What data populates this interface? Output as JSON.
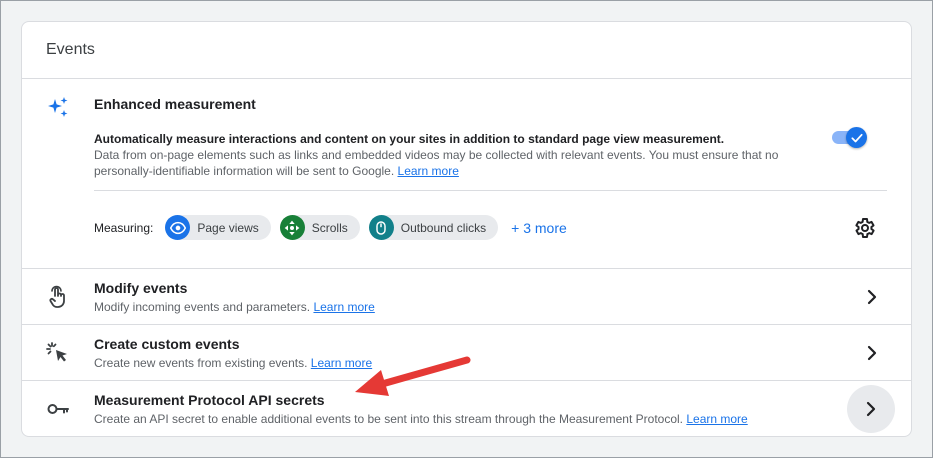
{
  "card": {
    "title": "Events"
  },
  "enhanced": {
    "title": "Enhanced measurement",
    "desc_bold": "Automatically measure interactions and content on your sites in addition to standard page view measurement.",
    "desc": "Data from on-page elements such as links and embedded videos may be collected with relevant events. You must ensure that no personally-identifiable information will be sent to Google.",
    "learn_more": "Learn more",
    "toggle_on": true,
    "measuring_label": "Measuring:",
    "chips": [
      {
        "label": "Page views",
        "icon": "eye-icon",
        "color": "#1a73e8"
      },
      {
        "label": "Scrolls",
        "icon": "scroll-arrows-icon",
        "color": "#188038"
      },
      {
        "label": "Outbound clicks",
        "icon": "mouse-icon",
        "color": "#12808a"
      }
    ],
    "more": "+ 3 more",
    "settings_icon": "gear-icon"
  },
  "rows": [
    {
      "title": "Modify events",
      "sub": "Modify incoming events and parameters.",
      "learn_more": "Learn more",
      "icon": "touch-hand-icon"
    },
    {
      "title": "Create custom events",
      "sub": "Create new events from existing events.",
      "learn_more": "Learn more",
      "icon": "cursor-click-icon"
    },
    {
      "title": "Measurement Protocol API secrets",
      "sub": "Create an API secret to enable additional events to be sent into this stream through the Measurement Protocol.",
      "learn_more": "Learn more",
      "icon": "key-icon"
    }
  ],
  "colors": {
    "accent": "#1a73e8",
    "annotation_arrow": "#e53935"
  }
}
